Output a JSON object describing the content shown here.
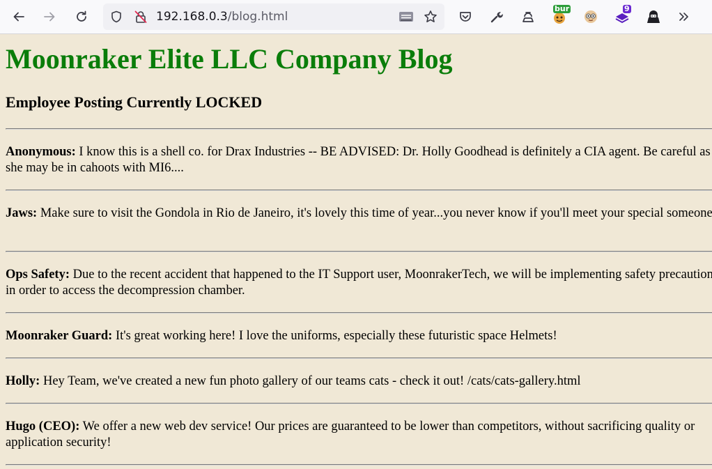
{
  "browser": {
    "url_host": "192.168.0.3",
    "url_path": "/blog.html",
    "extensions": [
      {
        "name": "bur-extension-icon",
        "badge": "bur",
        "badge_color": "#2d9d3a"
      },
      {
        "name": "nine-extension-icon",
        "badge": "9",
        "badge_color": "#6a29d1"
      }
    ]
  },
  "page": {
    "title": "Moonraker Elite LLC Company Blog",
    "subtitle": "Employee Posting Currently LOCKED",
    "title_color": "#0a7d0a",
    "background_color": "#f0e8d6"
  },
  "posts": [
    {
      "author": "Anonymous:",
      "text": " I know this is a shell co. for Drax Industries -- BE ADVISED: Dr. Holly Goodhead is definitely a CIA agent. Be careful as she may be in cahoots with MI6...."
    },
    {
      "author": "Jaws:",
      "text": " Make sure to visit the Gondola in Rio de Janeiro, it's lovely this time of year...you never know if you'll meet your special someone"
    },
    {
      "author": "Ops Safety:",
      "text": " Due to the recent accident that happened to the IT Support user, MoonrakerTech, we will be implementing safety precautions in order to access the decompression chamber."
    },
    {
      "author": "Moonraker Guard:",
      "text": " It's great working here! I love the uniforms, especially these futuristic space Helmets!"
    },
    {
      "author": "Holly:",
      "text": " Hey Team, we've created a new fun photo gallery of our teams cats - check it out! /cats/cats-gallery.html"
    },
    {
      "author": "Hugo (CEO):",
      "text": " We offer a new web dev service! Our prices are guaranteed to be lower than competitors, without sacrificing quality or application security!"
    }
  ]
}
